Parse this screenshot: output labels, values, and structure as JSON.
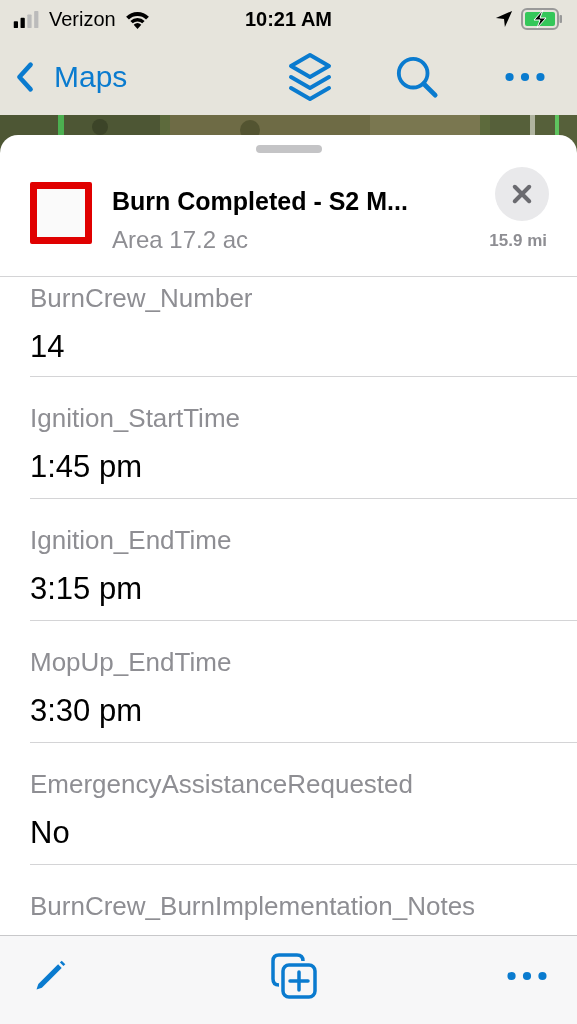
{
  "status_bar": {
    "carrier": "Verizon",
    "time": "10:21 AM"
  },
  "nav_bar": {
    "back_label": "Maps"
  },
  "feature": {
    "title": "Burn Completed - S2 M...",
    "subtitle": "Area 17.2 ac",
    "distance": "15.9 mi"
  },
  "fields": [
    {
      "label": "BurnCrew_Number",
      "value": "14"
    },
    {
      "label": "Ignition_StartTime",
      "value": "1:45 pm"
    },
    {
      "label": "Ignition_EndTime",
      "value": "3:15 pm"
    },
    {
      "label": "MopUp_EndTime",
      "value": "3:30 pm"
    },
    {
      "label": "EmergencyAssistanceRequested",
      "value": "No"
    },
    {
      "label": "BurnCrew_BurnImplementation_Notes"
    }
  ]
}
